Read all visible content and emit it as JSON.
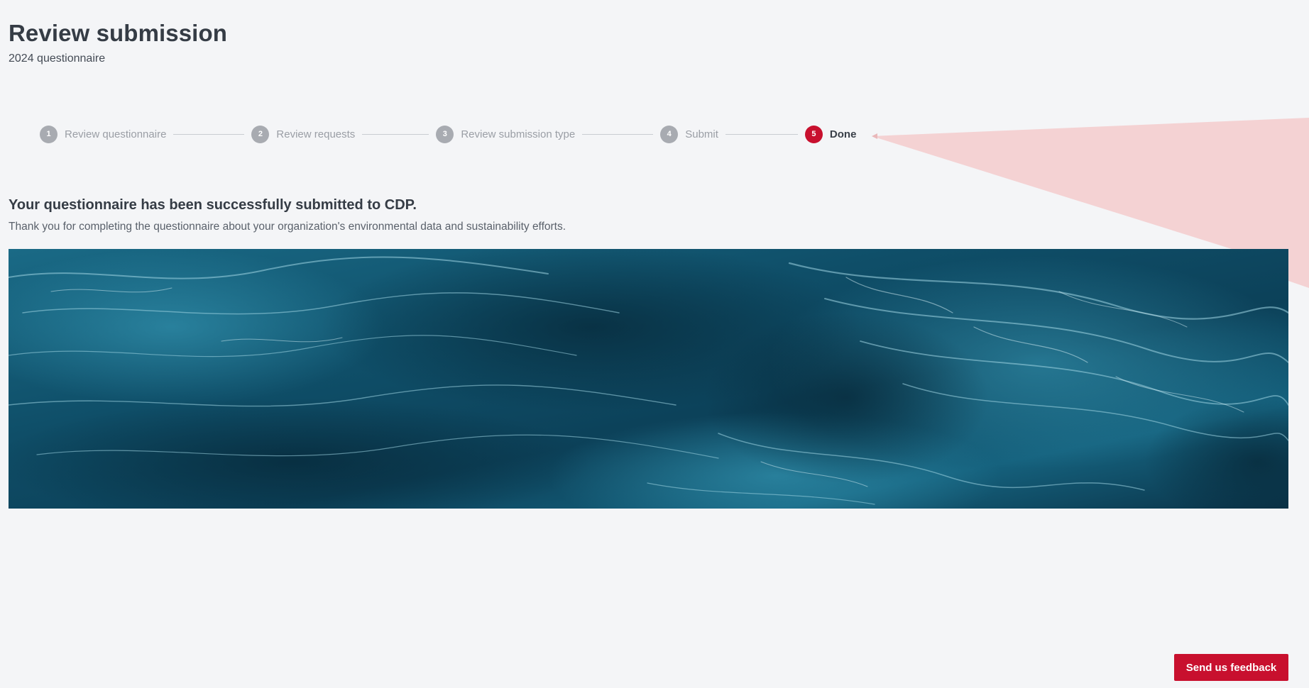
{
  "header": {
    "title": "Review submission",
    "subtitle": "2024 questionnaire"
  },
  "stepper": {
    "steps": [
      {
        "number": "1",
        "label": "Review questionnaire",
        "status": "completed"
      },
      {
        "number": "2",
        "label": "Review requests",
        "status": "completed"
      },
      {
        "number": "3",
        "label": "Review submission type",
        "status": "completed"
      },
      {
        "number": "4",
        "label": "Submit",
        "status": "completed"
      },
      {
        "number": "5",
        "label": "Done",
        "status": "active"
      }
    ]
  },
  "confirmation": {
    "heading": "Your questionnaire has been successfully submitted to CDP.",
    "description": "Thank you for completing the questionnaire about your organization's environmental data and sustainability efforts."
  },
  "banner": {
    "icon": "ocean-waves-image"
  },
  "feedback": {
    "label": "Send us feedback"
  },
  "colors": {
    "accent": "#c8102e",
    "step_inactive": "#a8abb1",
    "background": "#f4f5f7",
    "highlight": "#f3d0d1",
    "ocean_dark": "#0c3d52",
    "ocean_light": "#2f8aa6"
  }
}
